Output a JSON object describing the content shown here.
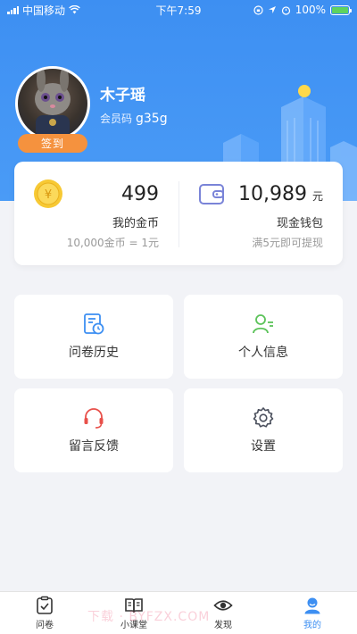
{
  "status_bar": {
    "carrier": "中国移动",
    "time": "下午7:59",
    "battery": "100%"
  },
  "profile": {
    "name": "木子瑶",
    "member_label": "会员码",
    "member_code": "g35g",
    "checkin_label": "签到"
  },
  "wallet": {
    "coins": {
      "amount": "499",
      "label": "我的金币",
      "note": "10,000金币 = 1元"
    },
    "cash": {
      "amount": "10,989",
      "unit": "元",
      "label": "现金钱包",
      "note": "满5元即可提现"
    }
  },
  "menu": {
    "survey_history": "问卷历史",
    "profile_info": "个人信息",
    "feedback": "留言反馈",
    "settings": "设置"
  },
  "tabbar": {
    "items": [
      {
        "label": "问卷",
        "icon": "clipboard-icon"
      },
      {
        "label": "小课堂",
        "icon": "book-icon"
      },
      {
        "label": "发现",
        "icon": "eye-icon"
      },
      {
        "label": "我的",
        "icon": "person-icon",
        "active": true
      }
    ]
  },
  "watermark": "下载 · BYFZX.COM",
  "colors": {
    "primary": "#3d8ff2",
    "checkin": "#f5923e",
    "coin": "#f7c934",
    "feedback_icon": "#e8504a",
    "profile_icon": "#5cc35a"
  }
}
